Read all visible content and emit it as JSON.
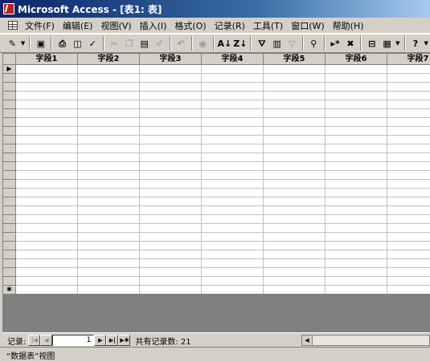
{
  "window": {
    "title": "Microsoft Access - [表1: 表]"
  },
  "menubar": {
    "items": [
      "文件(F)",
      "编辑(E)",
      "视图(V)",
      "插入(I)",
      "格式(O)",
      "记录(R)",
      "工具(T)",
      "窗口(W)",
      "帮助(H)"
    ]
  },
  "toolbar": {
    "buttons": [
      {
        "icon": "view-design-icon",
        "glyph": "✎",
        "enabled": true,
        "drop": true
      },
      {
        "sep": true
      },
      {
        "icon": "save-icon",
        "glyph": "▣",
        "enabled": true
      },
      {
        "sep": true
      },
      {
        "icon": "print-icon",
        "glyph": "⎙",
        "enabled": true
      },
      {
        "icon": "print-preview-icon",
        "glyph": "◫",
        "enabled": true
      },
      {
        "icon": "spelling-icon",
        "glyph": "✓",
        "enabled": true
      },
      {
        "sep": true
      },
      {
        "icon": "cut-icon",
        "glyph": "✂",
        "enabled": false
      },
      {
        "icon": "copy-icon",
        "glyph": "❐",
        "enabled": false
      },
      {
        "icon": "paste-icon",
        "glyph": "▤",
        "enabled": true
      },
      {
        "icon": "format-painter-icon",
        "glyph": "✐",
        "enabled": false
      },
      {
        "sep": true
      },
      {
        "icon": "undo-icon",
        "glyph": "↶",
        "enabled": false
      },
      {
        "sep": true
      },
      {
        "icon": "insert-hyperlink-icon",
        "glyph": "◉",
        "enabled": false
      },
      {
        "sep": true
      },
      {
        "icon": "sort-ascending-icon",
        "glyph": "A↓",
        "enabled": true
      },
      {
        "icon": "sort-descending-icon",
        "glyph": "Z↓",
        "enabled": true
      },
      {
        "sep": true
      },
      {
        "icon": "filter-by-selection-icon",
        "glyph": "⛛",
        "enabled": true
      },
      {
        "icon": "filter-by-form-icon",
        "glyph": "▥",
        "enabled": true
      },
      {
        "icon": "apply-filter-icon",
        "glyph": "▽",
        "enabled": false
      },
      {
        "sep": true
      },
      {
        "icon": "find-icon",
        "glyph": "⚲",
        "enabled": true
      },
      {
        "sep": true
      },
      {
        "icon": "new-record-icon",
        "glyph": "▸*",
        "enabled": true
      },
      {
        "icon": "delete-record-icon",
        "glyph": "✖",
        "enabled": true
      },
      {
        "sep": true
      },
      {
        "icon": "database-window-icon",
        "glyph": "⊟",
        "enabled": true
      },
      {
        "icon": "new-object-icon",
        "glyph": "▦",
        "enabled": true,
        "drop": true
      },
      {
        "sep": true
      },
      {
        "icon": "help-icon",
        "glyph": "?",
        "enabled": true,
        "drop": true
      }
    ]
  },
  "datasheet": {
    "columns": [
      "字段1",
      "字段2",
      "字段3",
      "字段4",
      "字段5",
      "字段6",
      "字段7"
    ],
    "blank_rows": 26,
    "current_row_marker": "▶",
    "new_row_marker": "✱"
  },
  "navigator": {
    "label": "记录:",
    "current_record": "1",
    "record_count_text": "共有记录数: 21"
  },
  "statusbar": {
    "text": "“数据表”视图"
  }
}
